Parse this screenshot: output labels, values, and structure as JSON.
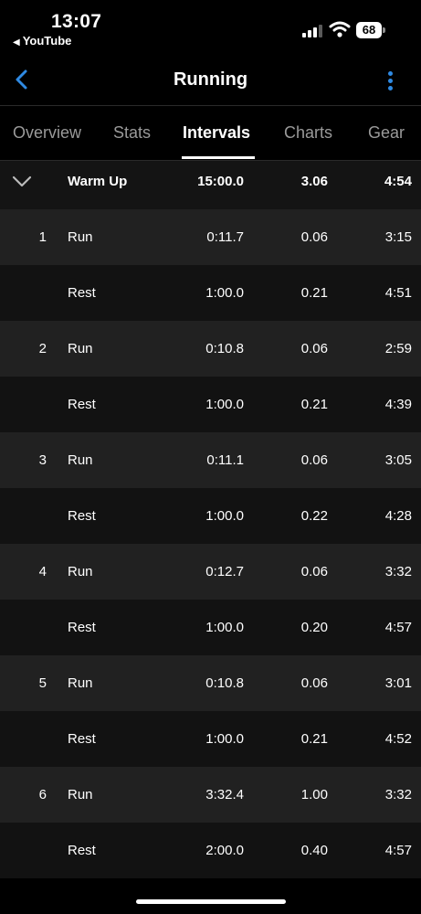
{
  "status": {
    "time": "13:07",
    "back_app": "YouTube",
    "battery": "68"
  },
  "nav": {
    "title": "Running"
  },
  "tabs": [
    {
      "label": "Overview"
    },
    {
      "label": "Stats"
    },
    {
      "label": "Intervals"
    },
    {
      "label": "Charts"
    },
    {
      "label": "Gear"
    }
  ],
  "active_tab": "Intervals",
  "warmup": {
    "label": "Warm Up",
    "time": "15:00.0",
    "distance": "3.06",
    "pace": "4:54"
  },
  "intervals": [
    {
      "num": "1",
      "label": "Run",
      "time": "0:11.7",
      "distance": "0.06",
      "pace": "3:15"
    },
    {
      "num": "",
      "label": "Rest",
      "time": "1:00.0",
      "distance": "0.21",
      "pace": "4:51"
    },
    {
      "num": "2",
      "label": "Run",
      "time": "0:10.8",
      "distance": "0.06",
      "pace": "2:59"
    },
    {
      "num": "",
      "label": "Rest",
      "time": "1:00.0",
      "distance": "0.21",
      "pace": "4:39"
    },
    {
      "num": "3",
      "label": "Run",
      "time": "0:11.1",
      "distance": "0.06",
      "pace": "3:05"
    },
    {
      "num": "",
      "label": "Rest",
      "time": "1:00.0",
      "distance": "0.22",
      "pace": "4:28"
    },
    {
      "num": "4",
      "label": "Run",
      "time": "0:12.7",
      "distance": "0.06",
      "pace": "3:32"
    },
    {
      "num": "",
      "label": "Rest",
      "time": "1:00.0",
      "distance": "0.20",
      "pace": "4:57"
    },
    {
      "num": "5",
      "label": "Run",
      "time": "0:10.8",
      "distance": "0.06",
      "pace": "3:01"
    },
    {
      "num": "",
      "label": "Rest",
      "time": "1:00.0",
      "distance": "0.21",
      "pace": "4:52"
    },
    {
      "num": "6",
      "label": "Run",
      "time": "3:32.4",
      "distance": "1.00",
      "pace": "3:32"
    },
    {
      "num": "",
      "label": "Rest",
      "time": "2:00.0",
      "distance": "0.40",
      "pace": "4:57"
    }
  ],
  "colors": {
    "accent": "#2f8ae3",
    "run_row": "#212121",
    "rest_row": "#121212"
  },
  "icons": {
    "back": "chevron-left-icon",
    "more": "more-vertical-icon",
    "collapse": "chevron-down-icon"
  }
}
